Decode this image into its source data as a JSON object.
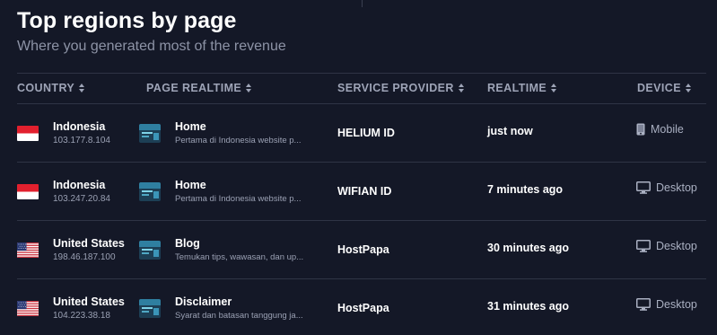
{
  "header": {
    "title": "Top regions by page",
    "subtitle": "Where you generated most of the revenue"
  },
  "table": {
    "columns": [
      {
        "label": "COUNTRY",
        "icon": "sort-icon"
      },
      {
        "label": "PAGE REALTIME",
        "icon": "sort-icon"
      },
      {
        "label": "SERVICE PROVIDER",
        "icon": "sort-icon"
      },
      {
        "label": "REALTIME",
        "icon": "sort-icon"
      },
      {
        "label": "DEVICE",
        "icon": "sort-icon"
      }
    ],
    "rows": [
      {
        "flag": "indonesia-flag-icon",
        "country": "Indonesia",
        "ip": "103.177.8.104",
        "page_title": "Home",
        "page_desc": "Pertama di Indonesia website p...",
        "provider": "HELIUM ID",
        "realtime": "just now",
        "device_icon": "mobile-icon",
        "device": "Mobile"
      },
      {
        "flag": "indonesia-flag-icon",
        "country": "Indonesia",
        "ip": "103.247.20.84",
        "page_title": "Home",
        "page_desc": "Pertama di Indonesia website p...",
        "provider": "WIFIAN ID",
        "realtime": "7 minutes ago",
        "device_icon": "desktop-icon",
        "device": "Desktop"
      },
      {
        "flag": "united-states-flag-icon",
        "country": "United States",
        "ip": "198.46.187.100",
        "page_title": "Blog",
        "page_desc": "Temukan tips, wawasan, dan up...",
        "provider": "HostPapa",
        "realtime": "30 minutes ago",
        "device_icon": "desktop-icon",
        "device": "Desktop"
      },
      {
        "flag": "united-states-flag-icon",
        "country": "United States",
        "ip": "104.223.38.18",
        "page_title": "Disclaimer",
        "page_desc": "Syarat dan batasan tanggung ja...",
        "provider": "HostPapa",
        "realtime": "31 minutes ago",
        "device_icon": "desktop-icon",
        "device": "Desktop"
      }
    ]
  },
  "colors": {
    "background": "#141827",
    "header_text": "#9ea4b7",
    "muted_text": "#8d93a6",
    "divider": "#2f3445"
  }
}
